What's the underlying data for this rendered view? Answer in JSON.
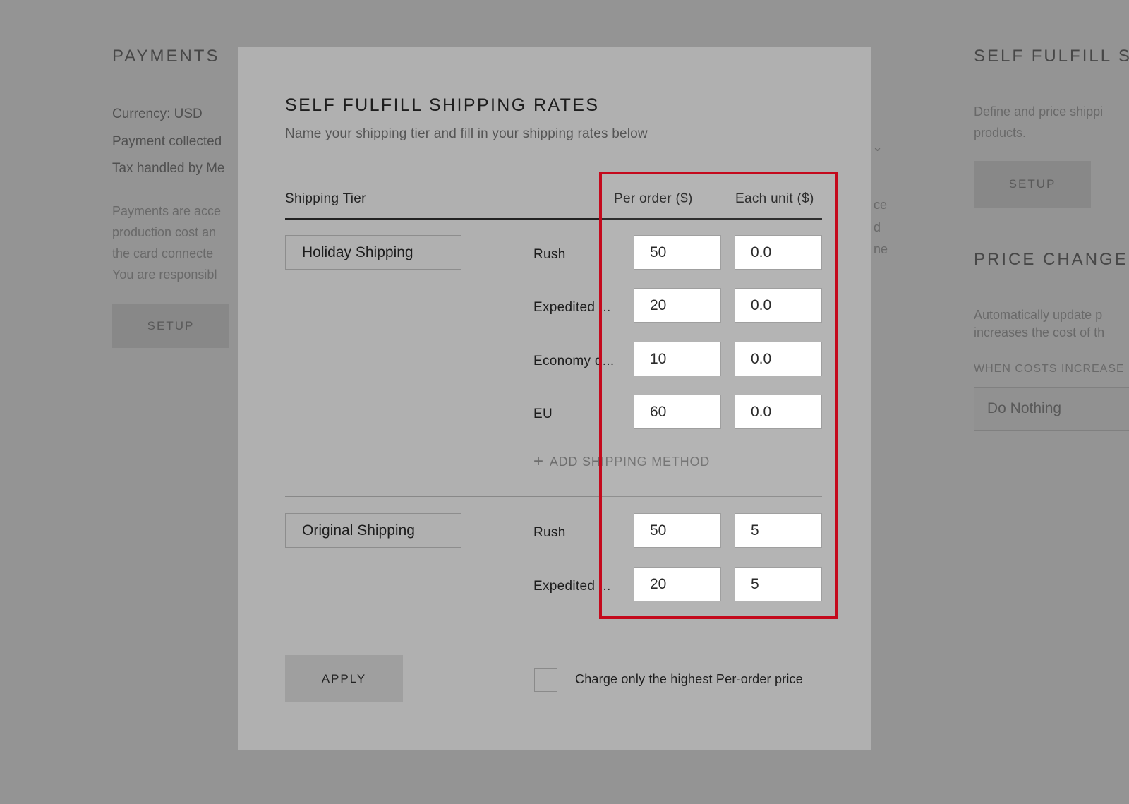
{
  "background": {
    "payments": {
      "heading": "PAYMENTS",
      "lines": [
        "Currency: USD",
        "Payment collected",
        "Tax handled by Me"
      ],
      "faint_lines": [
        "Payments are acce",
        "production cost an",
        "the card connecte",
        "You are responsibl"
      ],
      "setup_button": "SETUP"
    },
    "self_fulfill": {
      "heading": "SELF FULFILL SHI",
      "faint_lines": [
        "Define and price shippi",
        "products."
      ],
      "setup_button": "SETUP"
    },
    "middle_faint": [
      "ce",
      "d",
      "ne"
    ],
    "price_change": {
      "heading": "PRICE CHANGE PO",
      "faint_lines": [
        "Automatically update p",
        "increases the cost of th"
      ],
      "when_label": "WHEN COSTS INCREASE",
      "select_value": "Do Nothing"
    }
  },
  "modal": {
    "title": "SELF FULFILL SHIPPING RATES",
    "subtitle": "Name your shipping tier and fill in your shipping rates below",
    "columns": {
      "tier": "Shipping Tier",
      "per_order": "Per order ($)",
      "each_unit": "Each unit ($)"
    },
    "tiers": [
      {
        "name": "Holiday Shipping",
        "methods": [
          {
            "label": "Rush",
            "per_order": "50",
            "each_unit": "0.0"
          },
          {
            "label": "Expedited ...",
            "per_order": "20",
            "each_unit": "0.0"
          },
          {
            "label": "Economy d...",
            "per_order": "10",
            "each_unit": "0.0"
          },
          {
            "label": "EU",
            "per_order": "60",
            "each_unit": "0.0"
          }
        ],
        "add_method": "ADD SHIPPING METHOD"
      },
      {
        "name": "Original Shipping",
        "methods": [
          {
            "label": "Rush",
            "per_order": "50",
            "each_unit": "5"
          },
          {
            "label": "Expedited ...",
            "per_order": "20",
            "each_unit": "5"
          }
        ]
      }
    ],
    "apply_button": "APPLY",
    "checkbox_label": "Charge only the highest Per-order price"
  },
  "colors": {
    "highlight": "#c4091c",
    "modal_bg": "#b0b0b0",
    "overlay": "rgba(0,0,0,0.42)"
  }
}
